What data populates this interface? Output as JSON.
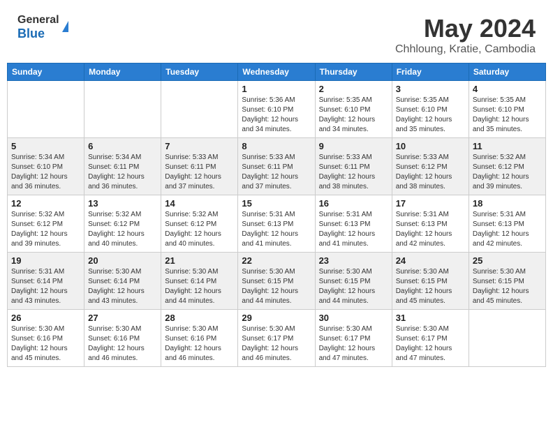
{
  "header": {
    "logo_general": "General",
    "logo_blue": "Blue",
    "title_month": "May 2024",
    "title_location": "Chhloung, Kratie, Cambodia"
  },
  "columns": [
    "Sunday",
    "Monday",
    "Tuesday",
    "Wednesday",
    "Thursday",
    "Friday",
    "Saturday"
  ],
  "weeks": [
    [
      {
        "day": "",
        "info": ""
      },
      {
        "day": "",
        "info": ""
      },
      {
        "day": "",
        "info": ""
      },
      {
        "day": "1",
        "info": "Sunrise: 5:36 AM\nSunset: 6:10 PM\nDaylight: 12 hours\nand 34 minutes."
      },
      {
        "day": "2",
        "info": "Sunrise: 5:35 AM\nSunset: 6:10 PM\nDaylight: 12 hours\nand 34 minutes."
      },
      {
        "day": "3",
        "info": "Sunrise: 5:35 AM\nSunset: 6:10 PM\nDaylight: 12 hours\nand 35 minutes."
      },
      {
        "day": "4",
        "info": "Sunrise: 5:35 AM\nSunset: 6:10 PM\nDaylight: 12 hours\nand 35 minutes."
      }
    ],
    [
      {
        "day": "5",
        "info": "Sunrise: 5:34 AM\nSunset: 6:10 PM\nDaylight: 12 hours\nand 36 minutes."
      },
      {
        "day": "6",
        "info": "Sunrise: 5:34 AM\nSunset: 6:11 PM\nDaylight: 12 hours\nand 36 minutes."
      },
      {
        "day": "7",
        "info": "Sunrise: 5:33 AM\nSunset: 6:11 PM\nDaylight: 12 hours\nand 37 minutes."
      },
      {
        "day": "8",
        "info": "Sunrise: 5:33 AM\nSunset: 6:11 PM\nDaylight: 12 hours\nand 37 minutes."
      },
      {
        "day": "9",
        "info": "Sunrise: 5:33 AM\nSunset: 6:11 PM\nDaylight: 12 hours\nand 38 minutes."
      },
      {
        "day": "10",
        "info": "Sunrise: 5:33 AM\nSunset: 6:12 PM\nDaylight: 12 hours\nand 38 minutes."
      },
      {
        "day": "11",
        "info": "Sunrise: 5:32 AM\nSunset: 6:12 PM\nDaylight: 12 hours\nand 39 minutes."
      }
    ],
    [
      {
        "day": "12",
        "info": "Sunrise: 5:32 AM\nSunset: 6:12 PM\nDaylight: 12 hours\nand 39 minutes."
      },
      {
        "day": "13",
        "info": "Sunrise: 5:32 AM\nSunset: 6:12 PM\nDaylight: 12 hours\nand 40 minutes."
      },
      {
        "day": "14",
        "info": "Sunrise: 5:32 AM\nSunset: 6:12 PM\nDaylight: 12 hours\nand 40 minutes."
      },
      {
        "day": "15",
        "info": "Sunrise: 5:31 AM\nSunset: 6:13 PM\nDaylight: 12 hours\nand 41 minutes."
      },
      {
        "day": "16",
        "info": "Sunrise: 5:31 AM\nSunset: 6:13 PM\nDaylight: 12 hours\nand 41 minutes."
      },
      {
        "day": "17",
        "info": "Sunrise: 5:31 AM\nSunset: 6:13 PM\nDaylight: 12 hours\nand 42 minutes."
      },
      {
        "day": "18",
        "info": "Sunrise: 5:31 AM\nSunset: 6:13 PM\nDaylight: 12 hours\nand 42 minutes."
      }
    ],
    [
      {
        "day": "19",
        "info": "Sunrise: 5:31 AM\nSunset: 6:14 PM\nDaylight: 12 hours\nand 43 minutes."
      },
      {
        "day": "20",
        "info": "Sunrise: 5:30 AM\nSunset: 6:14 PM\nDaylight: 12 hours\nand 43 minutes."
      },
      {
        "day": "21",
        "info": "Sunrise: 5:30 AM\nSunset: 6:14 PM\nDaylight: 12 hours\nand 44 minutes."
      },
      {
        "day": "22",
        "info": "Sunrise: 5:30 AM\nSunset: 6:15 PM\nDaylight: 12 hours\nand 44 minutes."
      },
      {
        "day": "23",
        "info": "Sunrise: 5:30 AM\nSunset: 6:15 PM\nDaylight: 12 hours\nand 44 minutes."
      },
      {
        "day": "24",
        "info": "Sunrise: 5:30 AM\nSunset: 6:15 PM\nDaylight: 12 hours\nand 45 minutes."
      },
      {
        "day": "25",
        "info": "Sunrise: 5:30 AM\nSunset: 6:15 PM\nDaylight: 12 hours\nand 45 minutes."
      }
    ],
    [
      {
        "day": "26",
        "info": "Sunrise: 5:30 AM\nSunset: 6:16 PM\nDaylight: 12 hours\nand 45 minutes."
      },
      {
        "day": "27",
        "info": "Sunrise: 5:30 AM\nSunset: 6:16 PM\nDaylight: 12 hours\nand 46 minutes."
      },
      {
        "day": "28",
        "info": "Sunrise: 5:30 AM\nSunset: 6:16 PM\nDaylight: 12 hours\nand 46 minutes."
      },
      {
        "day": "29",
        "info": "Sunrise: 5:30 AM\nSunset: 6:17 PM\nDaylight: 12 hours\nand 46 minutes."
      },
      {
        "day": "30",
        "info": "Sunrise: 5:30 AM\nSunset: 6:17 PM\nDaylight: 12 hours\nand 47 minutes."
      },
      {
        "day": "31",
        "info": "Sunrise: 5:30 AM\nSunset: 6:17 PM\nDaylight: 12 hours\nand 47 minutes."
      },
      {
        "day": "",
        "info": ""
      }
    ]
  ]
}
